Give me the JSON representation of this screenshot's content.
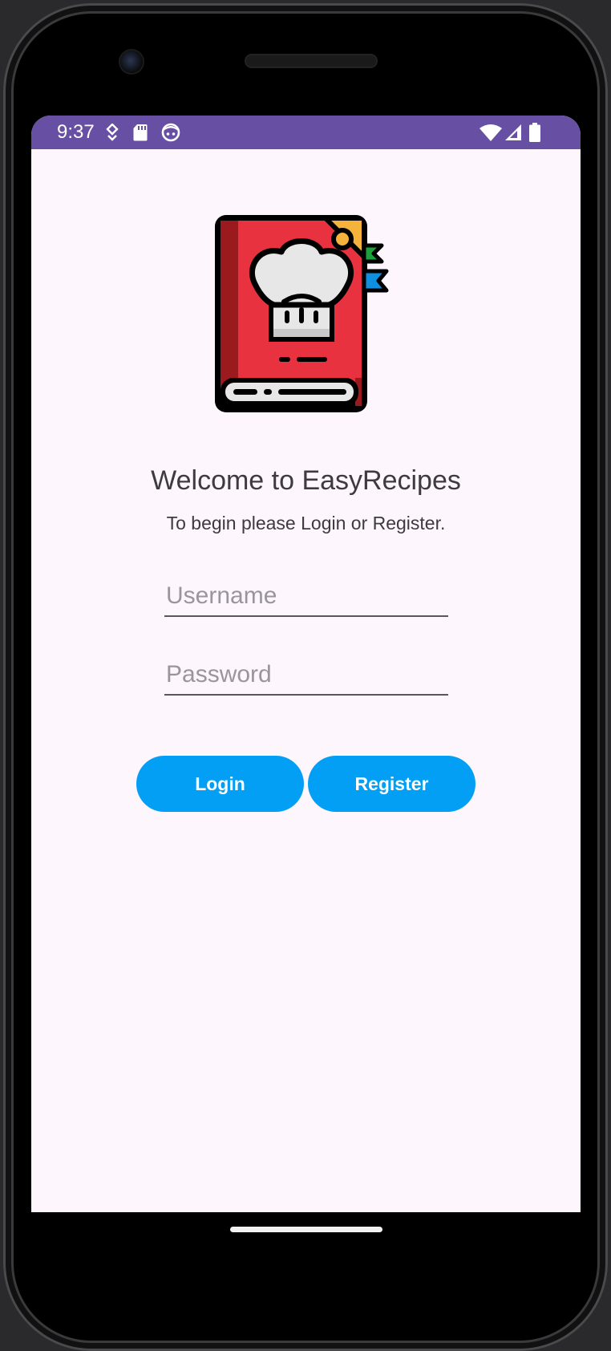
{
  "status_bar": {
    "time": "9:37",
    "icons": [
      "location-icon",
      "sd-card-icon",
      "face-icon",
      "wifi-icon",
      "cellular-signal-icon",
      "battery-icon"
    ]
  },
  "app": {
    "logo": "recipe-book-chef-hat-icon",
    "welcome_title": "Welcome to EasyRecipes",
    "subtitle": "To begin please Login or Register."
  },
  "form": {
    "username_placeholder": "Username",
    "username_value": "",
    "password_placeholder": "Password",
    "password_value": ""
  },
  "buttons": {
    "login_label": "Login",
    "register_label": "Register"
  },
  "colors": {
    "status_bar": "#6750a4",
    "screen_background": "#fdf6fc",
    "button": "#039ff5",
    "book_cover": "#e8323f",
    "book_spine": "#9b1a1e"
  }
}
